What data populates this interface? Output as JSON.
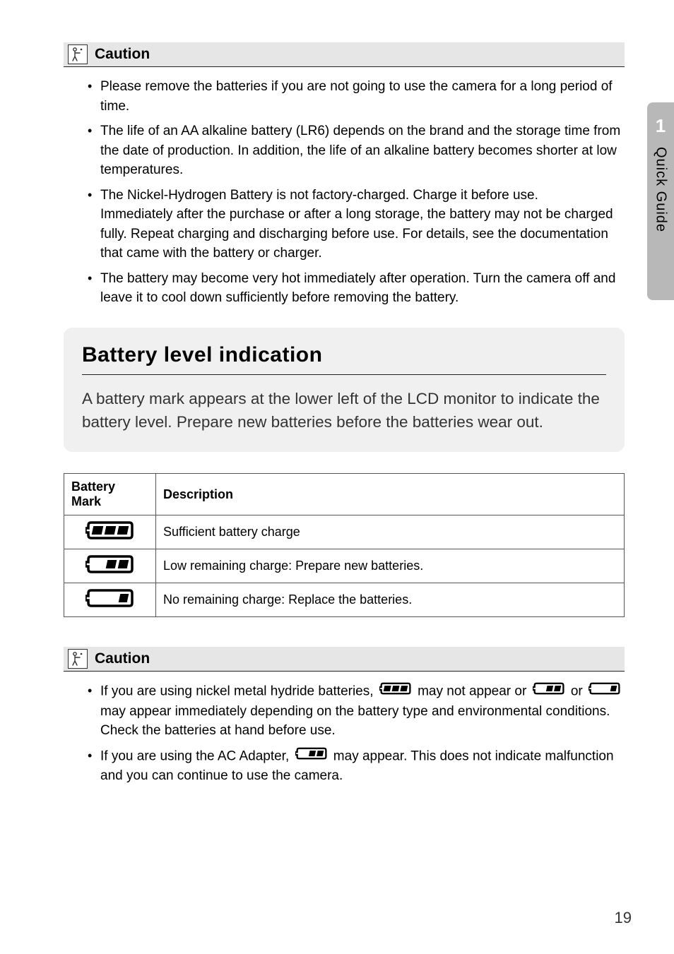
{
  "sidebar": {
    "chapter_number": "1",
    "chapter_title": "Quick Guide"
  },
  "caution1": {
    "title": "Caution",
    "items": [
      "Please remove the batteries if you are not going to use the camera for a long period of time.",
      "The life of an AA alkaline battery (LR6) depends on the brand and the storage time from the date of production. In addition, the life of an alkaline battery becomes shorter at low temperatures.",
      "The Nickel-Hydrogen Battery is not factory-charged. Charge it before use.\nImmediately after the purchase or after a long storage, the battery may not be charged fully. Repeat charging and discharging before use. For details, see the documentation that came with the battery or charger.",
      "The battery may become very hot immediately after operation. Turn the camera off and leave it to cool down sufficiently before removing the battery."
    ]
  },
  "section": {
    "heading": "Battery level indication",
    "body": "A battery mark appears at the lower left of the LCD monitor to indicate the battery level. Prepare new batteries before the batteries wear out."
  },
  "table": {
    "col1": "Battery Mark",
    "col2": "Description",
    "rows": [
      {
        "icon": "battery-full-icon",
        "desc": "Sufficient battery charge"
      },
      {
        "icon": "battery-low-icon",
        "desc": "Low remaining charge: Prepare new batteries."
      },
      {
        "icon": "battery-empty-icon",
        "desc": "No remaining charge: Replace the batteries."
      }
    ]
  },
  "caution2": {
    "title": "Caution",
    "item1_part1": "If you are using nickel metal hydride batteries, ",
    "item1_part2": " may not appear or ",
    "item1_part3": " or ",
    "item1_part4": " may appear immediately depending on the battery type and environmental conditions. Check the batteries at hand before use.",
    "item2_part1": "If you are using the AC Adapter, ",
    "item2_part2": " may appear. This does not indicate malfunction and you can continue to use the camera."
  },
  "page_number": "19"
}
